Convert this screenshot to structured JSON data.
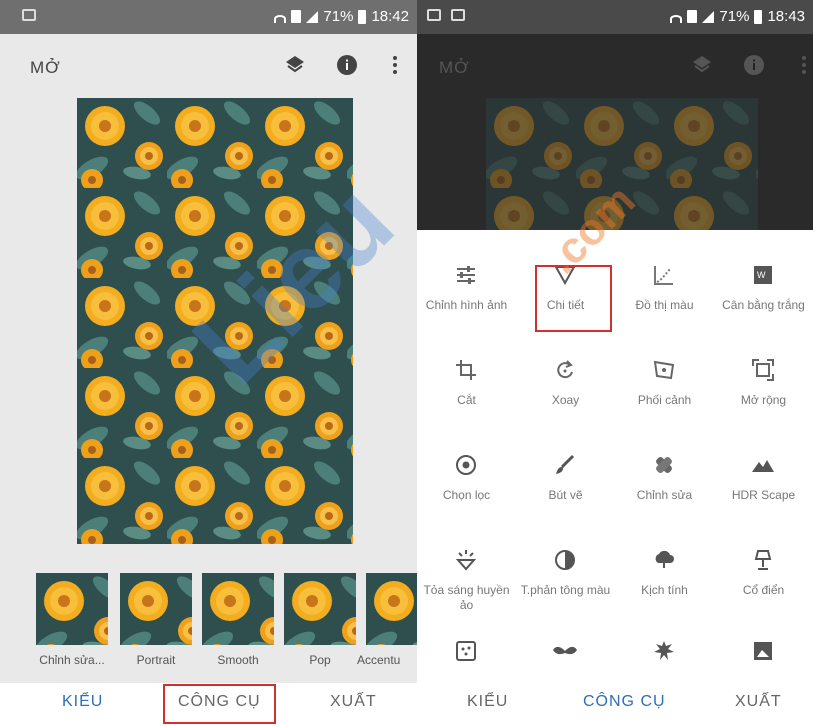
{
  "left": {
    "status": {
      "percent": "71%",
      "time": "18:42"
    },
    "appbar": {
      "title": "MỞ"
    },
    "looks": [
      {
        "label": "Chỉnh sửa..."
      },
      {
        "label": "Portrait"
      },
      {
        "label": "Smooth"
      },
      {
        "label": "Pop"
      },
      {
        "label": "Accentu"
      }
    ],
    "nav": {
      "styles": "KIỂU",
      "tools": "CÔNG CỤ",
      "export": "XUẤT"
    }
  },
  "right": {
    "status": {
      "percent": "71%",
      "time": "18:43"
    },
    "appbar": {
      "title": "MỞ"
    },
    "tools": [
      {
        "label": "Chỉnh hình ảnh",
        "icon": "tune-icon"
      },
      {
        "label": "Chi tiết",
        "icon": "details-triangle-icon"
      },
      {
        "label": "Đồ thị màu",
        "icon": "curves-icon"
      },
      {
        "label": "Cân bằng trắng",
        "icon": "white-balance-icon"
      },
      {
        "label": "Cắt",
        "icon": "crop-icon"
      },
      {
        "label": "Xoay",
        "icon": "rotate-icon"
      },
      {
        "label": "Phối cảnh",
        "icon": "perspective-icon"
      },
      {
        "label": "Mở rộng",
        "icon": "expand-icon"
      },
      {
        "label": "Chọn lọc",
        "icon": "selective-icon"
      },
      {
        "label": "Bút vẽ",
        "icon": "brush-icon"
      },
      {
        "label": "Chỉnh sửa",
        "icon": "healing-icon"
      },
      {
        "label": "HDR Scape",
        "icon": "mountain-icon"
      },
      {
        "label": "Tỏa sáng huyền ảo",
        "icon": "glamour-glow-icon"
      },
      {
        "label": "T.phản tông màu",
        "icon": "tonal-contrast-icon"
      },
      {
        "label": "Kịch tính",
        "icon": "drama-cloud-icon"
      },
      {
        "label": "Cổ điển",
        "icon": "vintage-lamp-icon"
      }
    ],
    "nav": {
      "styles": "KIỂU",
      "tools": "CÔNG CỤ",
      "export": "XUẤT"
    }
  },
  "watermark": "Lieu",
  "colors": {
    "accent": "#2d6fb8",
    "highlight": "#d32f2f",
    "flower": "#f2a91a",
    "leaf": "#3f6f6a"
  }
}
